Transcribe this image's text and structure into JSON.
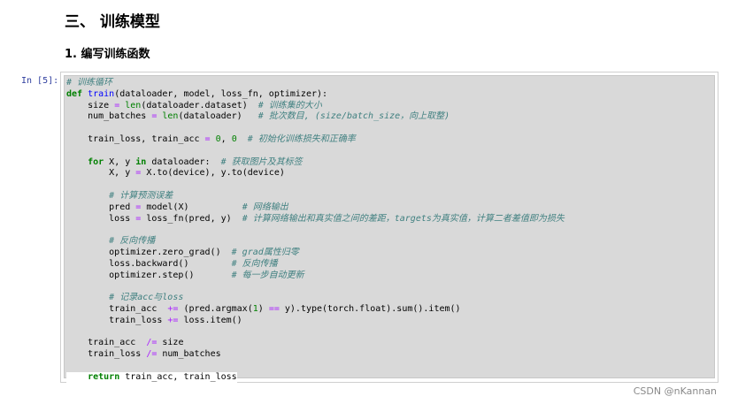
{
  "heading": "三、 训练模型",
  "subheading": "1. 编写训练函数",
  "cell": {
    "prompt": "In [5]:"
  },
  "code": {
    "lines": [
      [
        [
          "cm",
          "# 训练循环"
        ]
      ],
      [
        [
          "kw",
          "def"
        ],
        [
          "t",
          " "
        ],
        [
          "fn",
          "train"
        ],
        [
          "t",
          "(dataloader, model, loss_fn, optimizer):"
        ]
      ],
      [
        [
          "t",
          "    size "
        ],
        [
          "op",
          "="
        ],
        [
          "t",
          " "
        ],
        [
          "kw2",
          "len"
        ],
        [
          "t",
          "(dataloader.dataset)  "
        ],
        [
          "cm",
          "# 训练集的大小"
        ]
      ],
      [
        [
          "t",
          "    num_batches "
        ],
        [
          "op",
          "="
        ],
        [
          "t",
          " "
        ],
        [
          "kw2",
          "len"
        ],
        [
          "t",
          "(dataloader)   "
        ],
        [
          "cm",
          "# 批次数目, (size/batch_size，向上取整)"
        ]
      ],
      [
        [
          "t",
          ""
        ]
      ],
      [
        [
          "t",
          "    train_loss, train_acc "
        ],
        [
          "op",
          "="
        ],
        [
          "t",
          " "
        ],
        [
          "num",
          "0"
        ],
        [
          "t",
          ", "
        ],
        [
          "num",
          "0"
        ],
        [
          "t",
          "  "
        ],
        [
          "cm",
          "# 初始化训练损失和正确率"
        ]
      ],
      [
        [
          "t",
          ""
        ]
      ],
      [
        [
          "t",
          "    "
        ],
        [
          "kw",
          "for"
        ],
        [
          "t",
          " X, y "
        ],
        [
          "kw",
          "in"
        ],
        [
          "t",
          " dataloader:  "
        ],
        [
          "cm",
          "# 获取图片及其标签"
        ]
      ],
      [
        [
          "t",
          "        X, y "
        ],
        [
          "op",
          "="
        ],
        [
          "t",
          " X.to(device), y.to(device)"
        ]
      ],
      [
        [
          "t",
          ""
        ]
      ],
      [
        [
          "t",
          "        "
        ],
        [
          "cm",
          "# 计算预测误差"
        ]
      ],
      [
        [
          "t",
          "        pred "
        ],
        [
          "op",
          "="
        ],
        [
          "t",
          " model(X)          "
        ],
        [
          "cm",
          "# 网络输出"
        ]
      ],
      [
        [
          "t",
          "        loss "
        ],
        [
          "op",
          "="
        ],
        [
          "t",
          " loss_fn(pred, y)  "
        ],
        [
          "cm",
          "# 计算网络输出和真实值之间的差距，targets为真实值，计算二者差值即为损失"
        ]
      ],
      [
        [
          "t",
          ""
        ]
      ],
      [
        [
          "t",
          "        "
        ],
        [
          "cm",
          "# 反向传播"
        ]
      ],
      [
        [
          "t",
          "        optimizer.zero_grad()  "
        ],
        [
          "cm",
          "# grad属性归零"
        ]
      ],
      [
        [
          "t",
          "        loss.backward()        "
        ],
        [
          "cm",
          "# 反向传播"
        ]
      ],
      [
        [
          "t",
          "        optimizer.step()       "
        ],
        [
          "cm",
          "# 每一步自动更新"
        ]
      ],
      [
        [
          "t",
          ""
        ]
      ],
      [
        [
          "t",
          "        "
        ],
        [
          "cm",
          "# 记录acc与loss"
        ]
      ],
      [
        [
          "t",
          "        train_acc  "
        ],
        [
          "op",
          "+="
        ],
        [
          "t",
          " (pred.argmax("
        ],
        [
          "num",
          "1"
        ],
        [
          "t",
          ") "
        ],
        [
          "op",
          "=="
        ],
        [
          "t",
          " y).type(torch.float).sum().item()"
        ]
      ],
      [
        [
          "t",
          "        train_loss "
        ],
        [
          "op",
          "+="
        ],
        [
          "t",
          " loss.item()"
        ]
      ],
      [
        [
          "t",
          ""
        ]
      ],
      [
        [
          "t",
          "    train_acc  "
        ],
        [
          "op",
          "/="
        ],
        [
          "t",
          " size"
        ]
      ],
      [
        [
          "t",
          "    train_loss "
        ],
        [
          "op",
          "/="
        ],
        [
          "t",
          " num_batches"
        ]
      ],
      [
        [
          "t",
          ""
        ]
      ],
      [
        [
          "t",
          "    "
        ],
        [
          "kw",
          "return"
        ],
        [
          "t",
          " train_acc, train_loss"
        ]
      ]
    ]
  },
  "watermark": "CSDN @nKannan"
}
